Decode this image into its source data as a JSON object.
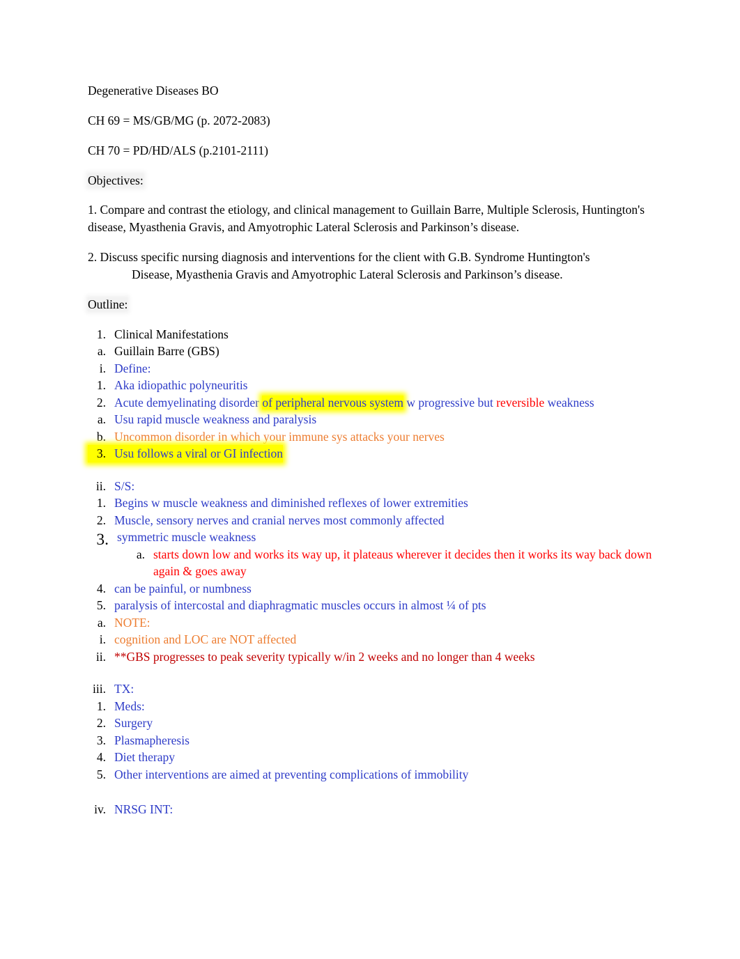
{
  "document": {
    "title": "Degenerative Diseases BO",
    "chapters": [
      "CH 69 = MS/GB/MG (p. 2072-2083)",
      "CH 70 = PD/HD/ALS (p.2101-2111)"
    ],
    "objectives_heading": "Objectives:",
    "objectives": [
      "1. Compare and contrast the etiology, and clinical management to Guillain Barre, Multiple Sclerosis, Huntington's disease, Myasthenia Gravis, and Amyotrophic Lateral Sclerosis and Parkinson’s disease.",
      "2. Discuss specific nursing diagnosis and interventions for the client with G.B. Syndrome Huntington's",
      "Disease, Myasthenia Gravis and Amyotrophic Lateral Sclerosis and Parkinson’s disease."
    ],
    "outline_heading": "Outline:"
  },
  "outline": {
    "l1_marker": "1.",
    "l1_label": "Clinical Manifestations",
    "l2_marker": "a.",
    "l2_label": "Guillain Barre (GBS)",
    "define": {
      "marker": "i.",
      "label": "Define:",
      "items": [
        {
          "marker": "1.",
          "text": "Aka idiopathic polyneuritis"
        },
        {
          "marker": "2.",
          "seg1": "Acute demyelinating disorder ",
          "seg2_highlight": "of peripheral nervous system",
          "seg3": " w progressive but ",
          "seg4_red": "reversible",
          "seg5": " weakness"
        },
        {
          "marker": "a.",
          "text": "Usu rapid muscle weakness and paralysis"
        },
        {
          "marker": "b.",
          "text": "Uncommon disorder in which your immune sys attacks your nerves"
        },
        {
          "marker": "3.",
          "text": "Usu follows a viral or GI infection"
        }
      ]
    },
    "ss": {
      "marker": "ii.",
      "label": "S/S:",
      "items": [
        {
          "marker": "1.",
          "text": "Begins w muscle weakness and diminished reflexes of lower extremities"
        },
        {
          "marker": "2.",
          "text": "Muscle, sensory nerves and cranial nerves most commonly affected"
        },
        {
          "marker": "3.",
          "text": "symmetric muscle weakness"
        },
        {
          "marker": "a.",
          "text": "starts down low and works its way up, it plateaus wherever it decides then it works its way back down again & goes away"
        },
        {
          "marker": "4.",
          "text": "can be painful, or numbness"
        },
        {
          "marker": "5.",
          "text": "paralysis of intercostal and diaphragmatic muscles occurs in almost ¼ of pts"
        }
      ],
      "note": {
        "marker": "a.",
        "label": "NOTE:",
        "sub": [
          {
            "marker": "i.",
            "text": "cognition and LOC are NOT affected"
          },
          {
            "marker": "ii.",
            "text": "**GBS progresses to peak severity typically w/in 2 weeks and no longer than 4 weeks"
          }
        ]
      }
    },
    "tx": {
      "marker": "iii.",
      "label": "TX:",
      "items": [
        {
          "marker": "1.",
          "text": "Meds:"
        },
        {
          "marker": "2.",
          "text": "Surgery"
        },
        {
          "marker": "3.",
          "text": "Plasmapheresis"
        },
        {
          "marker": "4.",
          "text": "Diet therapy"
        },
        {
          "marker": "5.",
          "text": "Other interventions are aimed at preventing complications of immobility"
        }
      ]
    },
    "nrsg": {
      "marker": "iv.",
      "label": "NRSG INT:"
    }
  },
  "colors": {
    "blue": "#2e3cc8",
    "orange": "#ed7d31",
    "red": "#ff0000",
    "dark_red": "#c00000",
    "highlight": "#ffff00",
    "shading": "#f2f2f2"
  }
}
